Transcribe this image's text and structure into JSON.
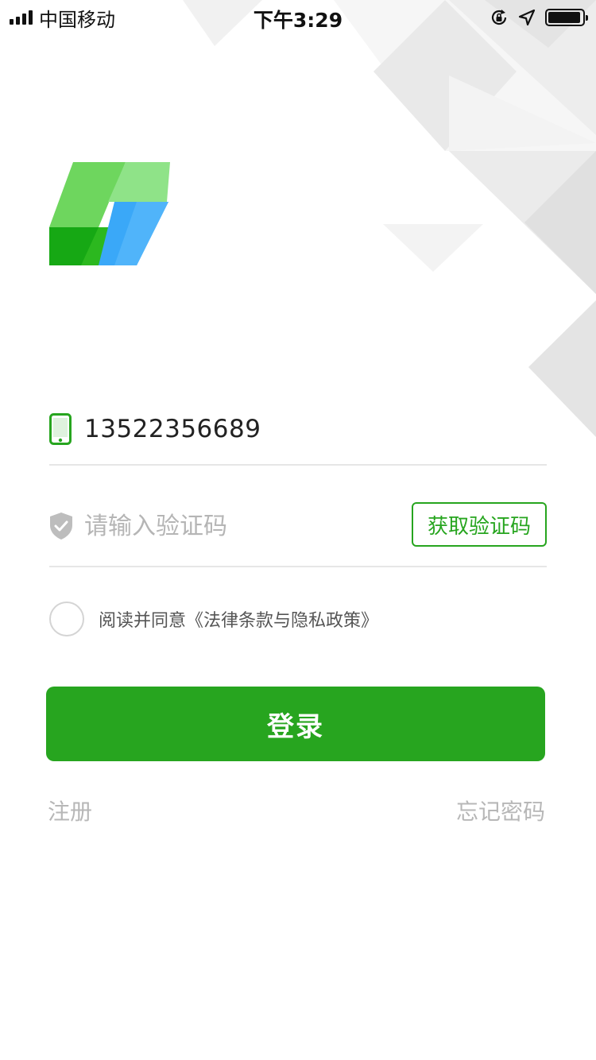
{
  "status_bar": {
    "carrier": "中国移动",
    "time": "下午3:29",
    "battery_level": 0.95
  },
  "login_form": {
    "phone_value": "13522356689",
    "code_placeholder": "请输入验证码",
    "get_code_label": "获取验证码",
    "agreement_text": "阅读并同意《法律条款与隐私政策》",
    "agreement_checked": false,
    "login_label": "登录",
    "register_label": "注册",
    "forgot_label": "忘记密码"
  },
  "colors": {
    "accent": "#27a51f",
    "placeholder": "#b5b5b5",
    "link": "#b7b7b7",
    "divider": "#e6e6e6"
  },
  "icons": [
    "signal-icon",
    "orientation-lock-icon",
    "location-arrow-icon",
    "battery-icon",
    "phone-icon",
    "shield-check-icon",
    "app-logo"
  ]
}
